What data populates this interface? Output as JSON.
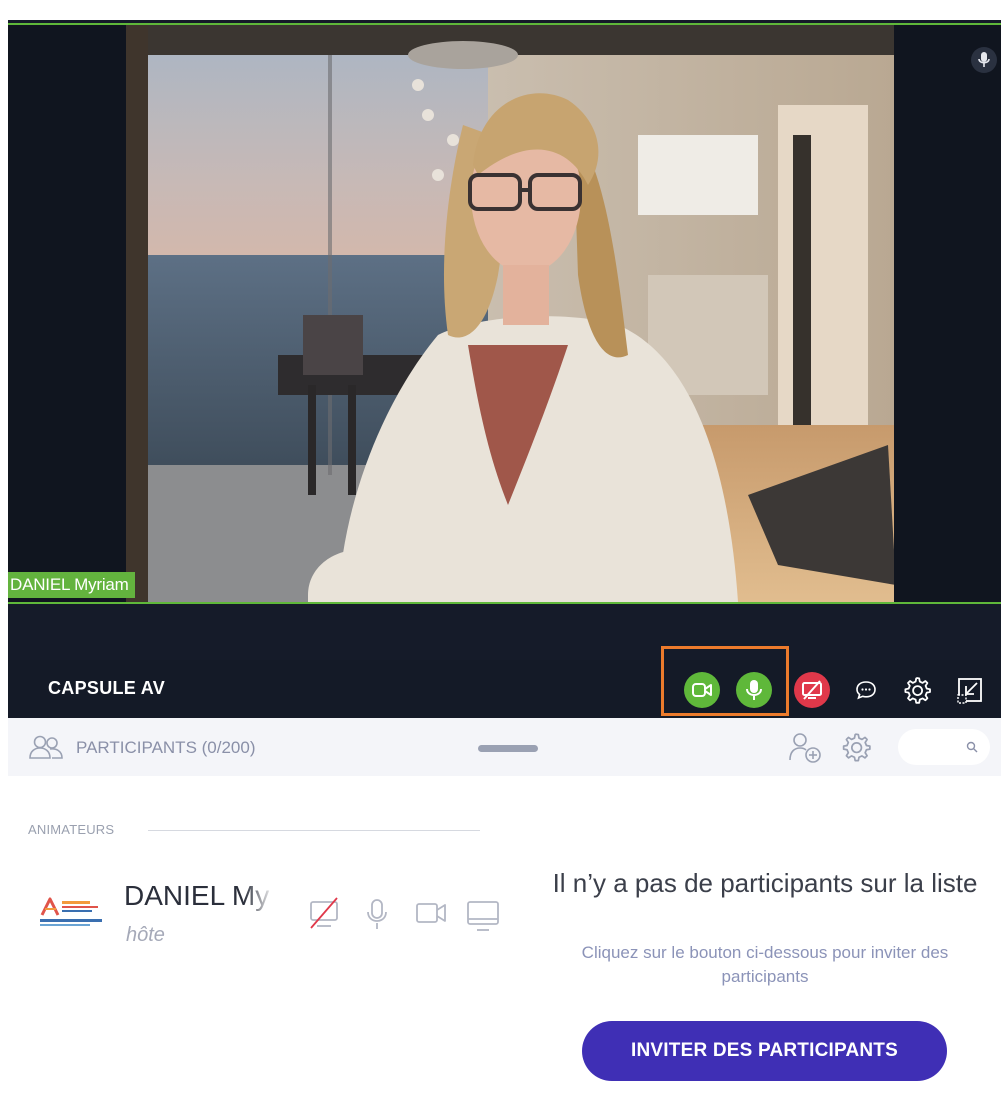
{
  "video": {
    "participant_name": "DANIEL Myriam",
    "mic_icon": "microphone-icon"
  },
  "toolbar": {
    "title": "CAPSULE AV",
    "buttons": [
      {
        "name": "camera-toggle",
        "icon": "video-camera-icon",
        "state": "on",
        "color": "#5fb83a"
      },
      {
        "name": "mic-toggle",
        "icon": "microphone-icon",
        "state": "on",
        "color": "#5fb83a"
      },
      {
        "name": "screen-share-toggle",
        "icon": "screen-share-off-icon",
        "state": "off",
        "color": "#e0384a"
      },
      {
        "name": "chat",
        "icon": "chat-bubble-icon"
      },
      {
        "name": "settings",
        "icon": "gear-icon"
      },
      {
        "name": "minimize",
        "icon": "minimize-window-icon"
      }
    ],
    "highlight_color": "#ec7b2c"
  },
  "participants": {
    "header": "PARTICIPANTS (0/200)",
    "section_label": "ANIMATEURS",
    "host": {
      "name": "DANIEL My",
      "role": "hôte",
      "logo_icon": "organization-logo"
    },
    "empty_state": {
      "title": "Il n’y a pas de participants sur la liste",
      "subtitle": "Cliquez sur le bouton ci-dessous pour inviter des participants",
      "button": "INVITER DES PARTICIPANTS"
    }
  },
  "colors": {
    "accent_green": "#5fb83a",
    "alert_red": "#e0384a",
    "primary_button": "#3f2fb5",
    "dark_panel": "#141a27"
  }
}
